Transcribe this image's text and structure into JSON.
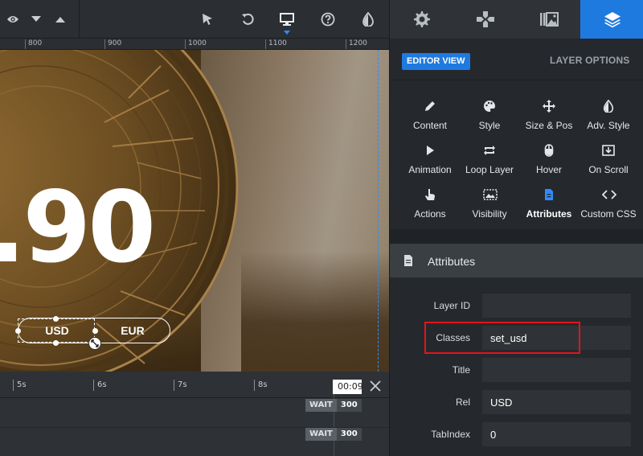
{
  "toolbar": {
    "icons": [
      "eye-icon",
      "chevron-down-icon",
      "chevron-up-icon",
      "cursor-icon",
      "undo-icon",
      "desktop-icon",
      "help-icon",
      "contrast-icon"
    ]
  },
  "ruler": {
    "labels": [
      "800",
      "900",
      "1000",
      "1100",
      "1200"
    ]
  },
  "canvas": {
    "price_text": ".90",
    "toggle": {
      "option_1": "USD",
      "option_2": "EUR"
    }
  },
  "timeline": {
    "ticks": [
      "5s",
      "6s",
      "7s",
      "8s"
    ],
    "current_time": "00:09",
    "rows": [
      {
        "wait_label": "WAIT",
        "wait_value": "300"
      },
      {
        "wait_label": "WAIT",
        "wait_value": "300"
      }
    ]
  },
  "panel": {
    "tabs": [
      "settings-icon",
      "gamepad-icon",
      "media-library-icon",
      "layers-icon"
    ],
    "active_tab": "layers-icon",
    "editor_view_label": "EDITOR VIEW",
    "layer_options_label": "LAYER OPTIONS",
    "options": [
      {
        "label": "Content",
        "icon": "pencil-icon"
      },
      {
        "label": "Style",
        "icon": "palette-icon"
      },
      {
        "label": "Size & Pos",
        "icon": "move-icon"
      },
      {
        "label": "Adv. Style",
        "icon": "contrast-icon"
      },
      {
        "label": "Animation",
        "icon": "play-icon"
      },
      {
        "label": "Loop Layer",
        "icon": "loop-icon"
      },
      {
        "label": "Hover",
        "icon": "mouse-icon"
      },
      {
        "label": "On Scroll",
        "icon": "download-icon"
      },
      {
        "label": "Actions",
        "icon": "hand-pointer-icon"
      },
      {
        "label": "Visibility",
        "icon": "visibility-icon"
      },
      {
        "label": "Attributes",
        "icon": "document-icon"
      },
      {
        "label": "Custom CSS",
        "icon": "code-icon"
      }
    ],
    "active_option": "Attributes",
    "section_title": "Attributes",
    "fields": {
      "layer_id": {
        "label": "Layer ID",
        "value": ""
      },
      "classes": {
        "label": "Classes",
        "value": "set_usd"
      },
      "title": {
        "label": "Title",
        "value": ""
      },
      "rel": {
        "label": "Rel",
        "value": "USD"
      },
      "tabindex": {
        "label": "TabIndex",
        "value": "0"
      }
    }
  },
  "colors": {
    "accent": "#1f7ae0",
    "highlight": "#e0151c",
    "panel_bg": "#25292d"
  }
}
